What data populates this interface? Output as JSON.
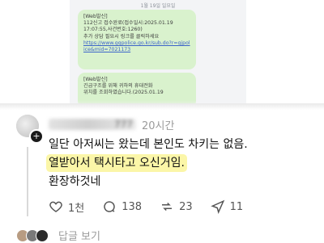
{
  "sms": {
    "date": "1월 19일 일요일",
    "msg1": {
      "header": "[Web발신]",
      "lines": [
        "112신고 접수완료(접수일시:2025.01.19",
        "17:07:55,사건번호:1260)",
        "추가 상담 필요시 링크를 클릭하세요"
      ],
      "link": "https://www.gqpolice.go.kr/sub.do?r=gjpolice&mid=7021173"
    },
    "msg2": {
      "header": "[Web발신]",
      "lines": [
        "긴급구조를 위해 귀하의 휴대전화",
        "위치를 조회하였습니다.(2025.01.19"
      ]
    }
  },
  "comment": {
    "username": "777",
    "time": "20시간",
    "line1": "일단 아저씨는 왔는데 본인도 차키는 없음.",
    "line2": "열받아서 택시타고 오신거임.",
    "line3": "환장하것네"
  },
  "actions": {
    "likes": "1천",
    "comments": "138",
    "reposts": "23",
    "shares": "11"
  },
  "replies": {
    "label": "답글 보기"
  },
  "colors": {
    "highlight": "#fbf6a8",
    "bubble": "#d9f2cd"
  }
}
